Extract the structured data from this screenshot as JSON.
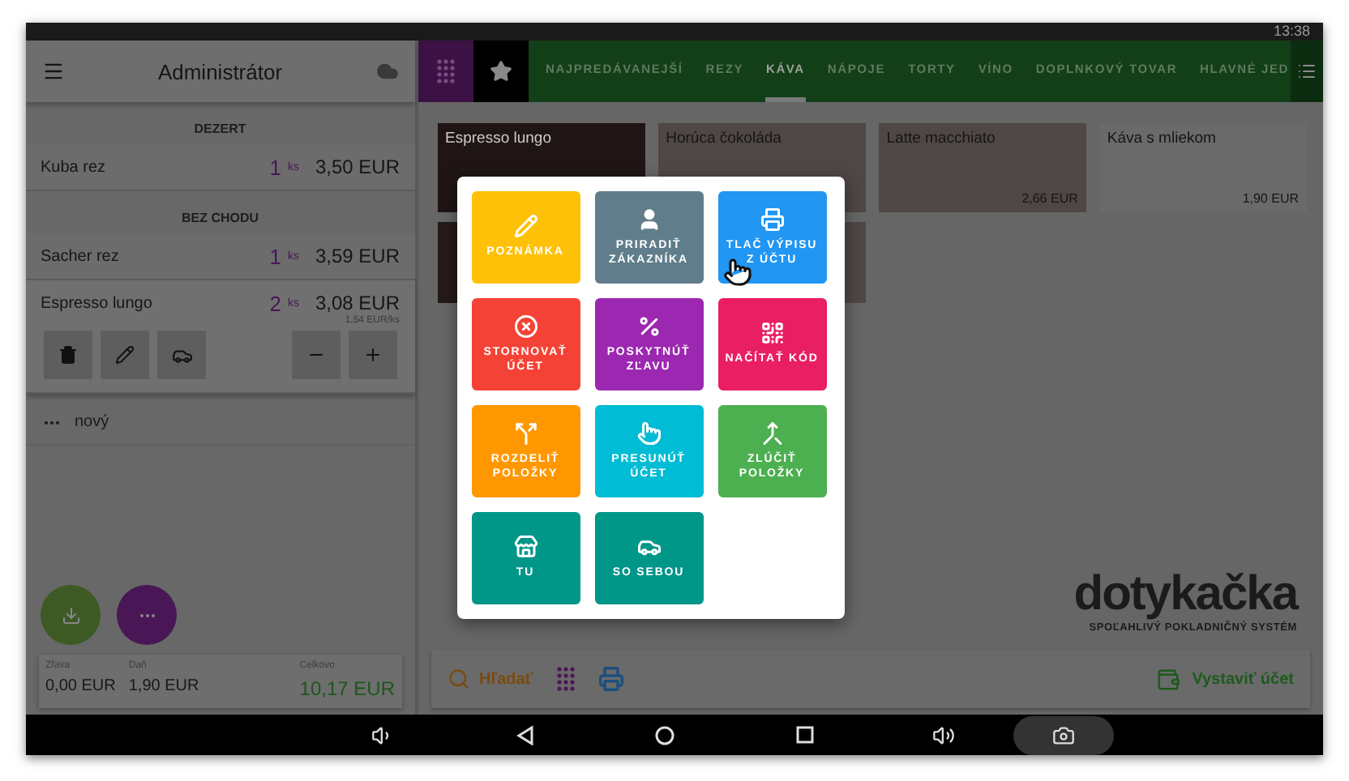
{
  "status_bar": {
    "time": "13:38"
  },
  "order_panel": {
    "title": "Administrátor",
    "sections": [
      {
        "name": "DEZERT",
        "items": [
          {
            "name": "Kuba rez",
            "qty": "1",
            "unit": "ks",
            "price": "3,50 EUR",
            "expanded": false
          }
        ]
      },
      {
        "name": "BEZ CHODU",
        "items": [
          {
            "name": "Sacher rez",
            "qty": "1",
            "unit": "ks",
            "price": "3,59 EUR",
            "expanded": false
          },
          {
            "name": "Espresso lungo",
            "qty": "2",
            "unit": "ks",
            "price": "3,08 EUR",
            "unit_price": "1,54 EUR/ks",
            "expanded": true
          }
        ]
      }
    ],
    "draft": {
      "label": "nový"
    },
    "summary": [
      {
        "label": "Zľava",
        "value": "0,00 EUR",
        "kind": "plain"
      },
      {
        "label": "Daň",
        "value": "1,90 EUR",
        "kind": "plain"
      },
      {
        "label": "Celkovo",
        "value": "10,17 EUR",
        "kind": "total"
      }
    ]
  },
  "categories": [
    {
      "label": "NAJPREDÁVANEJŠÍ",
      "selected": false
    },
    {
      "label": "REZY",
      "selected": false
    },
    {
      "label": "KÁVA",
      "selected": true
    },
    {
      "label": "NÁPOJE",
      "selected": false
    },
    {
      "label": "TORTY",
      "selected": false
    },
    {
      "label": "VÍNO",
      "selected": false
    },
    {
      "label": "DOPLNKOVÝ TOVAR",
      "selected": false
    },
    {
      "label": "HLAVNÉ JED",
      "selected": false
    }
  ],
  "products": [
    {
      "name": "Espresso lungo",
      "color": "#1e1514"
    },
    {
      "name": "Horúca čokoláda",
      "color": "#4f4745"
    },
    {
      "name": "Latte macchiato",
      "price": "2,66 EUR",
      "color": "#4f4745"
    },
    {
      "name": "Káva s mliekom",
      "price": "1,90 EUR",
      "color": "#6a6a6a"
    }
  ],
  "action_menu": {
    "actions": [
      {
        "label": "POZNÁMKA",
        "color": "#ffc107"
      },
      {
        "label": "PRIRADIŤ ZÁKAZNÍKA",
        "color": "#607d8b"
      },
      {
        "label": "TLAČ VÝPISU Z ÚČTU",
        "color": "#2196f3"
      },
      {
        "label": "STORNOVAŤ ÚČET",
        "color": "#f44336"
      },
      {
        "label": "POSKYTNÚŤ ZĽAVU",
        "color": "#9c27b0"
      },
      {
        "label": "NAČÍTAŤ KÓD",
        "color": "#e91e63"
      },
      {
        "label": "ROZDELIŤ POLOŽKY",
        "color": "#ff9800"
      },
      {
        "label": "PRESUNÚŤ ÚČET",
        "color": "#00bcd4"
      },
      {
        "label": "ZLÚČIŤ POLOŽKY",
        "color": "#4caf50"
      },
      {
        "label": "TU",
        "color": "#009688"
      },
      {
        "label": "SO SEBOU",
        "color": "#009688"
      }
    ]
  },
  "logo": {
    "wordmark": "dotykačka",
    "tagline": "SPOĽAHLIVÝ POKLADNIČNÝ SYSTÉM"
  },
  "toolbar": {
    "search_label": "Hľadať",
    "issue_label": "Vystaviť účet"
  }
}
